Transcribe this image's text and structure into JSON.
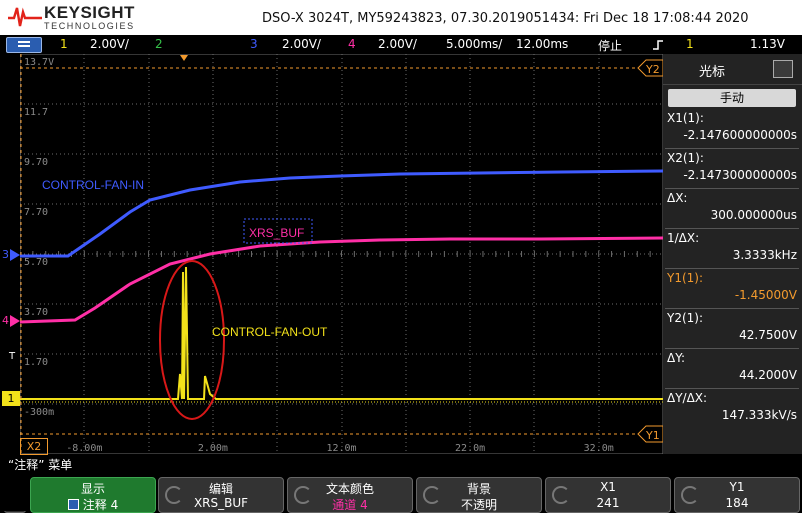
{
  "header": {
    "brand": "KEYSIGHT",
    "brand_sub": "TECHNOLOGIES",
    "title": "DSO-X 3024T, MY59243823, 07.30.2019051434: Fri Dec 18 17:08:44 2020"
  },
  "channel_bar": {
    "ch1_num": "1",
    "ch1_scale": "2.00V/",
    "ch2_num": "2",
    "ch3_num": "3",
    "ch3_scale": "2.00V/",
    "ch4_num": "4",
    "ch4_scale": "2.00V/",
    "timebase": "5.000ms/",
    "delay": "12.00ms",
    "run_state": "停止",
    "trigger_src": "1",
    "trigger_level": "1.13V"
  },
  "grid": {
    "y_labels": [
      "13.7V",
      "11.7",
      "9.70",
      "7.70",
      "5.70",
      "3.70",
      "1.70",
      "-300m"
    ],
    "x_labels": [
      "-8.00m",
      "2.00m",
      "12.0m",
      "22.0m",
      "32.0m"
    ],
    "markers": {
      "y2": "Y2",
      "y1": "Y1",
      "x2": "X2",
      "ch3": "3",
      "ch4": "4",
      "ch1": "1",
      "trig": "T"
    }
  },
  "annotations": {
    "fan_in": "CONTROL-FAN-IN",
    "xrs_buf": "XRS_BUF",
    "fan_out": "CONTROL-FAN-OUT"
  },
  "cursor_panel": {
    "title": "光标",
    "mode": "手动",
    "rows": [
      {
        "key": "X1(1):",
        "value": "-2.147600000000s"
      },
      {
        "key": "X2(1):",
        "value": "-2.147300000000s"
      },
      {
        "key": "ΔX:",
        "value": "300.000000us"
      },
      {
        "key": "1/ΔX:",
        "value": "3.3333kHz"
      },
      {
        "key": "Y1(1):",
        "value": "-1.45000V"
      },
      {
        "key": "Y2(1):",
        "value": "42.7500V"
      },
      {
        "key": "ΔY:",
        "value": "44.2000V"
      },
      {
        "key": "ΔY/ΔX:",
        "value": "147.333kV/s"
      }
    ]
  },
  "softkeys": {
    "caption": "“注释” 菜单",
    "keys": [
      {
        "top": "显示",
        "bottom": "注释 4"
      },
      {
        "top": "编辑",
        "bottom": "XRS_BUF"
      },
      {
        "top": "文本颜色",
        "bottom": "通道 4"
      },
      {
        "top": "背景",
        "bottom": "不透明"
      },
      {
        "top": "X1",
        "bottom": "241"
      },
      {
        "top": "Y1",
        "bottom": "184"
      }
    ]
  },
  "colors": {
    "ch1": "#f2e11a",
    "ch2": "#36c24a",
    "ch3": "#3f5bff",
    "ch4": "#ff2fa6",
    "grid": "#6b6b6b",
    "ellipse": "#d81818",
    "accent": "#f29a2e"
  }
}
